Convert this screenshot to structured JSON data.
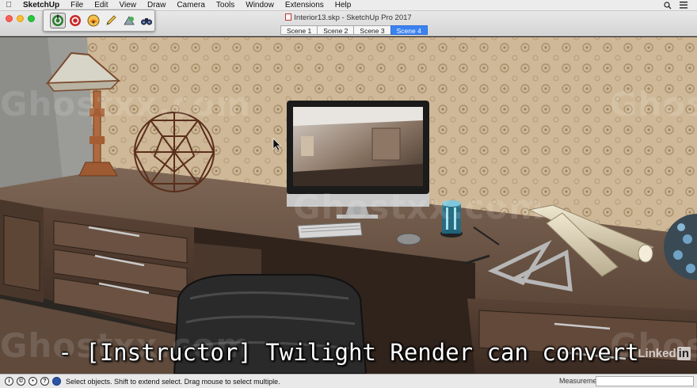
{
  "menubar": {
    "app": "SketchUp",
    "items": [
      "File",
      "Edit",
      "View",
      "Draw",
      "Camera",
      "Tools",
      "Window",
      "Extensions",
      "Help"
    ],
    "right_icons": [
      "search-icon",
      "list-icon"
    ]
  },
  "window": {
    "title": "Interior13.skp - SketchUp Pro 2017"
  },
  "scenes": {
    "tabs": [
      "Scene 1",
      "Scene 2",
      "Scene 3",
      "Scene 4"
    ],
    "active_index": 3
  },
  "toolbar": {
    "tools": [
      "twilight-render-icon",
      "stop-render-icon",
      "settings-icon",
      "pencil-icon",
      "material-editor-icon",
      "binoculars-icon"
    ]
  },
  "overlay": {
    "watermark": "Ghostxx.com",
    "subtitle": "- [Instructor] Twilight Render can convert",
    "linkedin_text": "Linked",
    "linkedin_in": "in"
  },
  "status": {
    "icons": [
      "info-icon",
      "credit-icon",
      "geolocation-icon",
      "question-icon",
      "select-tool-icon"
    ],
    "text": "Select objects. Shift to extend select. Drag mouse to select multiple.",
    "measurements_label": "Measurements",
    "measurements_value": ""
  },
  "colors": {
    "accent": "#3b82f0",
    "desk": "#6b5546",
    "wallpaper": "#c8b295"
  }
}
